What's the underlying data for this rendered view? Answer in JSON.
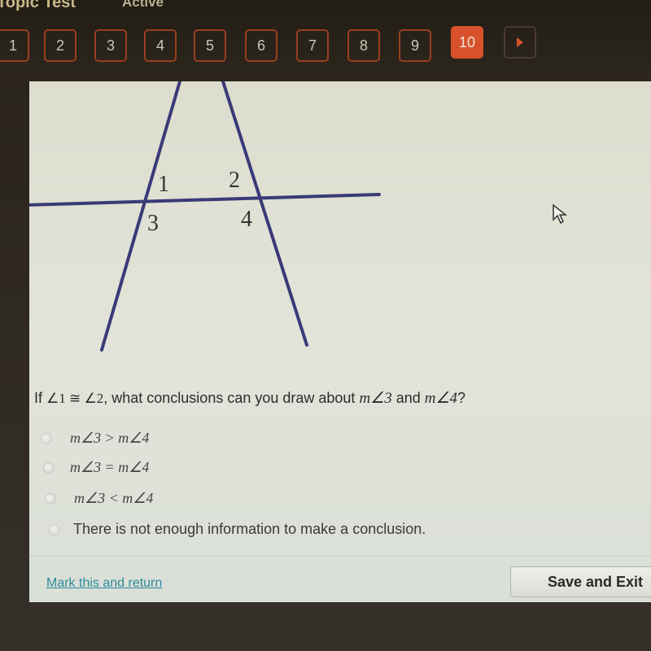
{
  "header": {
    "title": "Topic Test",
    "status": "Active"
  },
  "question_nav": {
    "items": [
      {
        "label": "1",
        "state": "default"
      },
      {
        "label": "2",
        "state": "default"
      },
      {
        "label": "3",
        "state": "default"
      },
      {
        "label": "4",
        "state": "default"
      },
      {
        "label": "5",
        "state": "default"
      },
      {
        "label": "6",
        "state": "default"
      },
      {
        "label": "7",
        "state": "default"
      },
      {
        "label": "8",
        "state": "default"
      },
      {
        "label": "9",
        "state": "default"
      },
      {
        "label": "10",
        "state": "active"
      }
    ],
    "next_icon": "play-triangle-icon",
    "active_color": "#d8512b",
    "border_color": "#9a3e20"
  },
  "diagram": {
    "labels": [
      "1",
      "2",
      "3",
      "4"
    ],
    "line_color": "#3b3a78",
    "description": "Two transversals crossing a horizontal line, forming angles 1, 2 (above) and 3, 4 (below)"
  },
  "question": {
    "prefix": "If ",
    "given": "∠1 ≅ ∠2",
    "middle": ", what conclusions can you draw about ",
    "a": "m∠3",
    "and": " and ",
    "b": "m∠4",
    "suffix": "?"
  },
  "options": [
    {
      "label": "m∠3 > m∠4",
      "is_math": true,
      "selected": false
    },
    {
      "label": "m∠3 = m∠4",
      "is_math": true,
      "selected": false
    },
    {
      "label": "m∠3 < m∠4",
      "is_math": true,
      "selected": false
    },
    {
      "label": "There is not enough information to make a conclusion.",
      "is_math": false,
      "selected": false
    }
  ],
  "footer": {
    "mark_link": "Mark this and return",
    "save_button": "Save and Exit"
  }
}
